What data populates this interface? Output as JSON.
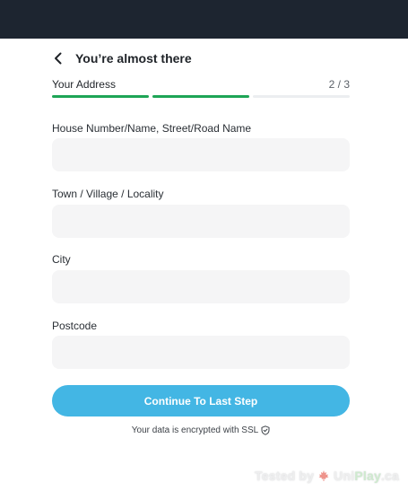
{
  "header": {
    "back_icon": "chevron-left-icon",
    "title": "You’re almost there"
  },
  "progress": {
    "step_label": "Your Address",
    "step_count": "2 / 3",
    "completed_segments": 2,
    "total_segments": 3,
    "complete_color": "#1ea556",
    "incomplete_color": "#eceef0"
  },
  "form": {
    "fields": [
      {
        "label": "House Number/Name, Street/Road Name",
        "value": "",
        "placeholder": ""
      },
      {
        "label": "Town / Village / Locality",
        "value": "",
        "placeholder": ""
      },
      {
        "label": "City",
        "value": "",
        "placeholder": ""
      },
      {
        "label": "Postcode",
        "value": "",
        "placeholder": ""
      }
    ],
    "submit_label": "Continue To Last Step",
    "submit_color": "#43b6e4",
    "ssl_note": "Your data is encrypted with SSL",
    "ssl_icon": "shield-check-icon"
  },
  "watermark": {
    "prefix": "Tested by",
    "brand_part1": "Uni",
    "brand_part2": "Play",
    "brand_part3": ".ca",
    "flag_icon": "maple-leaf-icon"
  },
  "colors": {
    "topbar": "#1d2530",
    "input_bg": "#f5f5f6"
  }
}
